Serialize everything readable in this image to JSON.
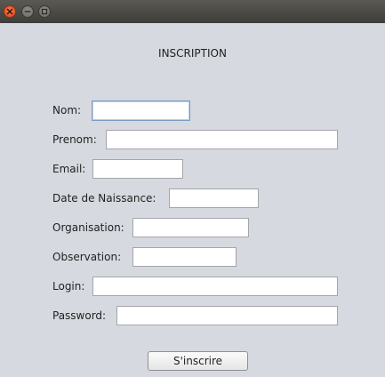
{
  "title": "INSCRIPTION",
  "fields": {
    "nom": {
      "label": "Nom:",
      "value": ""
    },
    "prenom": {
      "label": "Prenom:",
      "value": ""
    },
    "email": {
      "label": "Email:",
      "value": ""
    },
    "date_naissance": {
      "label": "Date de Naissance:",
      "value": ""
    },
    "organisation": {
      "label": "Organisation:",
      "value": ""
    },
    "observation": {
      "label": "Observation:",
      "value": ""
    },
    "login": {
      "label": "Login:",
      "value": ""
    },
    "password": {
      "label": "Password:",
      "value": ""
    }
  },
  "submit_label": "S'inscrire",
  "window_controls": [
    "close-icon",
    "minimize-icon",
    "maximize-icon"
  ],
  "colors": {
    "background": "#d6d9df",
    "titlebar": "#3e3d39",
    "close": "#e0552b",
    "focus_border": "#7d9cc4"
  }
}
